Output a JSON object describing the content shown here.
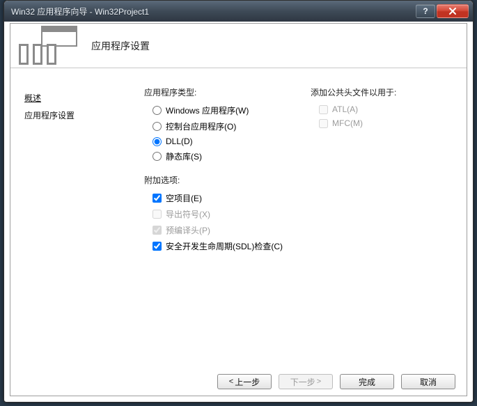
{
  "window": {
    "title": "Win32 应用程序向导 - Win32Project1"
  },
  "banner": {
    "title": "应用程序设置"
  },
  "nav": {
    "items": [
      {
        "label": "概述"
      },
      {
        "label": "应用程序设置"
      }
    ]
  },
  "apptype": {
    "label": "应用程序类型:",
    "options": [
      {
        "label": "Windows 应用程序(W)",
        "checked": false
      },
      {
        "label": "控制台应用程序(O)",
        "checked": false
      },
      {
        "label": "DLL(D)",
        "checked": true
      },
      {
        "label": "静态库(S)",
        "checked": false
      }
    ]
  },
  "additional": {
    "label": "附加选项:",
    "options": [
      {
        "label": "空项目(E)",
        "checked": true,
        "disabled": false
      },
      {
        "label": "导出符号(X)",
        "checked": false,
        "disabled": true
      },
      {
        "label": "预编译头(P)",
        "checked": true,
        "disabled": true
      },
      {
        "label": "安全开发生命周期(SDL)检查(C)",
        "checked": true,
        "disabled": false
      }
    ]
  },
  "headers": {
    "label": "添加公共头文件以用于:",
    "options": [
      {
        "label": "ATL(A)",
        "checked": false,
        "disabled": true
      },
      {
        "label": "MFC(M)",
        "checked": false,
        "disabled": true
      }
    ]
  },
  "buttons": {
    "prev": "上一步",
    "next": "下一步",
    "finish": "完成",
    "cancel": "取消"
  }
}
